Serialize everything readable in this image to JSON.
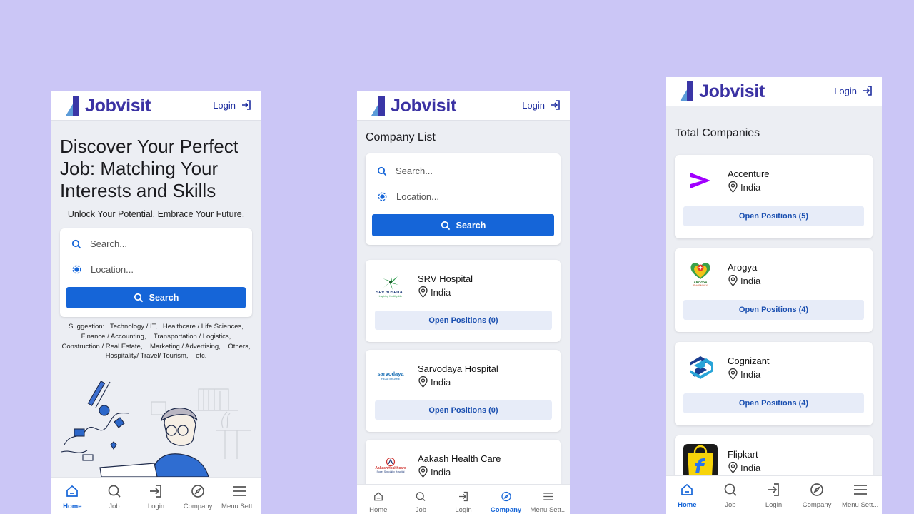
{
  "brand": {
    "name": "Jobvisit",
    "login_label": "Login",
    "accent": "#1565d8",
    "logo_color": "#3b32a3"
  },
  "screen_home": {
    "hero_title": "Discover Your Perfect Job: Matching Your Interests and Skills",
    "hero_subtitle": "Unlock Your Potential, Embrace Your Future.",
    "search": {
      "keyword_placeholder": "Search...",
      "location_placeholder": "Location...",
      "button_label": "Search"
    },
    "suggestion_label": "Suggestion:",
    "suggestions": [
      "Technology / IT,",
      "Healthcare / Life Sciences,",
      "Finance / Accounting,",
      "Transportation / Logistics,",
      "Construction / Real Estate,",
      "Marketing / Advertising,",
      "Others,",
      "Hospitality/ Travel/ Tourism,",
      "etc."
    ]
  },
  "screen_company_list": {
    "title": "Company List",
    "search": {
      "keyword_placeholder": "Search...",
      "location_placeholder": "Location...",
      "button_label": "Search"
    },
    "companies": [
      {
        "name": "SRV Hospital",
        "location": "India",
        "positions_label": "Open Positions (0)",
        "logo_text": "SRV HOSPITAL",
        "logo_tagline": "Inspiring Healthy Life"
      },
      {
        "name": "Sarvodaya Hospital",
        "location": "India",
        "positions_label": "Open Positions (0)",
        "logo_text": "sarvodaya",
        "logo_tagline": "HEALTHCARE"
      },
      {
        "name": "Aakash Health Care",
        "location": "India",
        "logo_text": "AakashHealthcare",
        "logo_tagline": "Super Speciality Hospital"
      }
    ]
  },
  "screen_total_companies": {
    "title": "Total Companies",
    "companies": [
      {
        "name": "Accenture",
        "location": "India",
        "positions_label": "Open Positions (5)",
        "logo_icon": "accenture-chevron-icon"
      },
      {
        "name": "Arogya",
        "location": "India",
        "positions_label": "Open Positions (4)",
        "logo_text": "AROGYA",
        "logo_tagline": "PHARMACY"
      },
      {
        "name": "Cognizant",
        "location": "India",
        "positions_label": "Open Positions (4)",
        "logo_icon": "cognizant-icon"
      },
      {
        "name": "Flipkart",
        "location": "India",
        "logo_icon": "flipkart-bag-icon"
      }
    ]
  },
  "bottom_nav": {
    "home": "Home",
    "job": "Job",
    "login": "Login",
    "company": "Company",
    "menu": "Menu Sett..."
  }
}
